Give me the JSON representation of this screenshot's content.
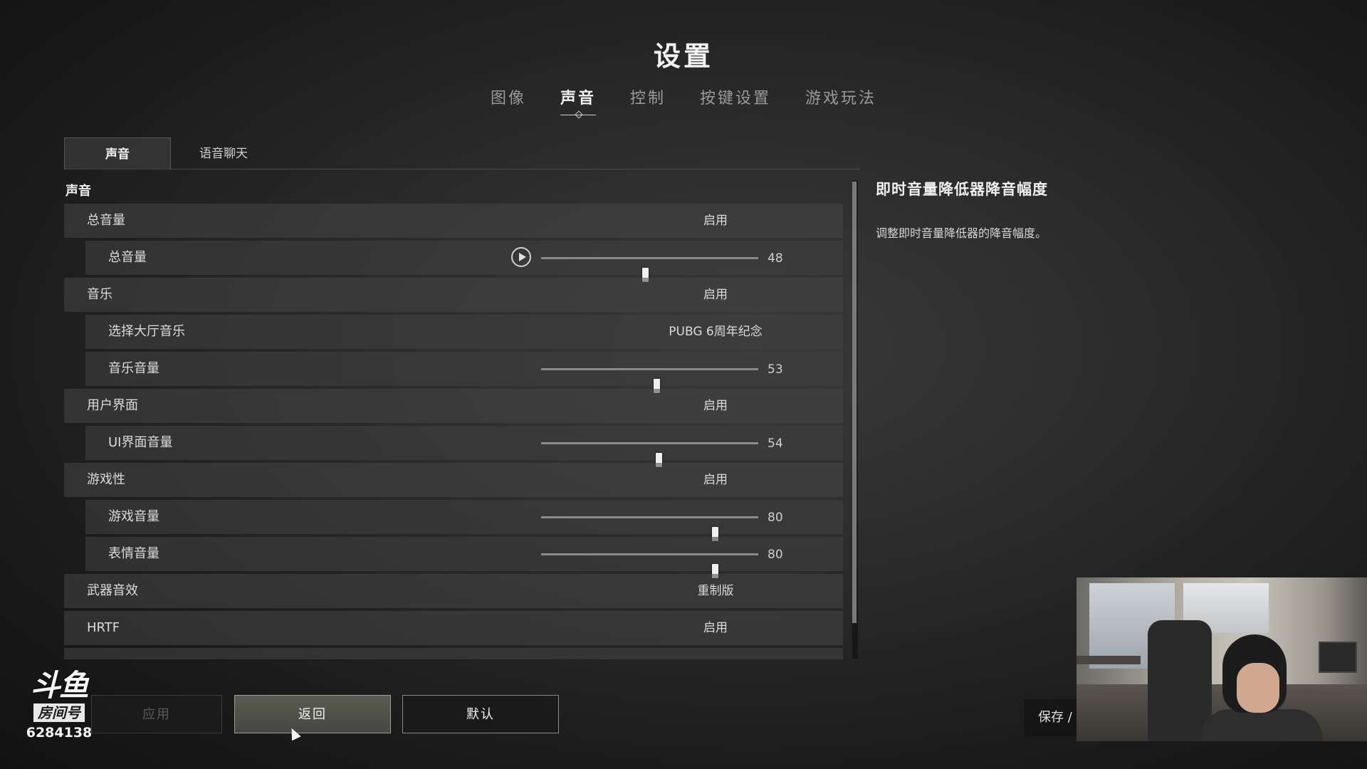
{
  "title": "设置",
  "top_tabs": [
    {
      "label": "图像",
      "active": false
    },
    {
      "label": "声音",
      "active": true
    },
    {
      "label": "控制",
      "active": false
    },
    {
      "label": "按键设置",
      "active": false
    },
    {
      "label": "游戏玩法",
      "active": false
    }
  ],
  "sub_tabs": [
    {
      "label": "声音",
      "active": true
    },
    {
      "label": "语音聊天",
      "active": false
    }
  ],
  "section_label": "声音",
  "rows": {
    "master": {
      "label": "总音量",
      "value": "启用"
    },
    "master_volume": {
      "label": "总音量",
      "value": 48
    },
    "music": {
      "label": "音乐",
      "value": "启用"
    },
    "lobby_music": {
      "label": "选择大厅音乐",
      "value": "PUBG 6周年纪念"
    },
    "music_volume": {
      "label": "音乐音量",
      "value": 53
    },
    "ui": {
      "label": "用户界面",
      "value": "启用"
    },
    "ui_volume": {
      "label": "UI界面音量",
      "value": 54
    },
    "gameplay": {
      "label": "游戏性",
      "value": "启用"
    },
    "game_volume": {
      "label": "游戏音量",
      "value": 80
    },
    "emote_volume": {
      "label": "表情音量",
      "value": 80
    },
    "weapon_sfx": {
      "label": "武器音效",
      "value": "重制版"
    },
    "hrtf": {
      "label": "HRTF",
      "value": "启用"
    }
  },
  "description": {
    "title": "即时音量降低器降音幅度",
    "text": "调整即时音量降低器的降音幅度。"
  },
  "buttons": {
    "apply": "应用",
    "back": "返回",
    "default": "默认"
  },
  "overlay": {
    "logo_text": "斗鱼",
    "room_label": "房间号",
    "room_number": "6284138",
    "save_label": "保存 /"
  },
  "colors": {
    "background": "#2a2a2a",
    "row": "#464646",
    "active_text": "#f2f2f2",
    "inactive_text": "#9a9a9a"
  }
}
